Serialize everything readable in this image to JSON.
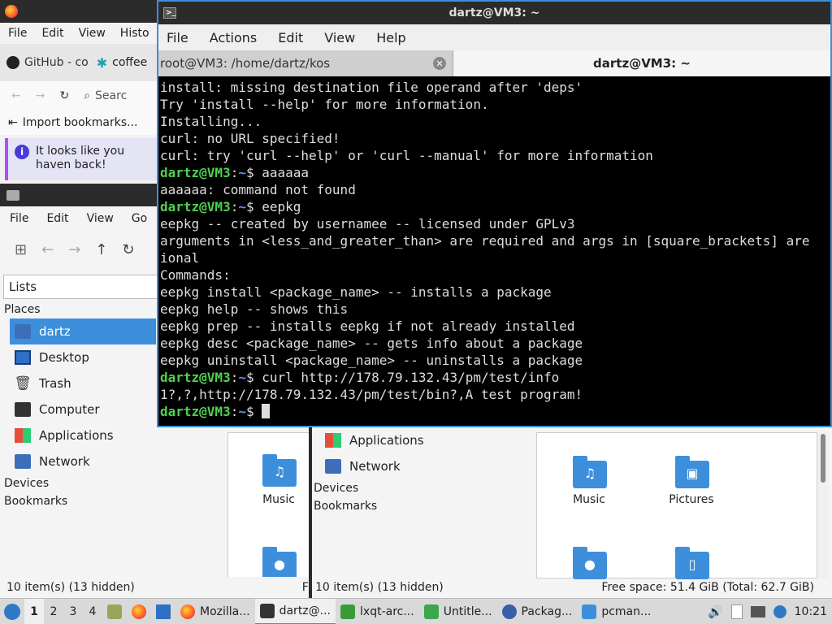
{
  "firefox": {
    "menu": [
      "File",
      "Edit",
      "View",
      "Histo"
    ],
    "tabs": [
      "GitHub - co",
      "coffee"
    ],
    "search_placeholder": "Searc",
    "bookmark": "Import bookmarks...",
    "notice": "It looks like you haven back!"
  },
  "file_manager_left": {
    "menu": [
      "File",
      "Edit",
      "View",
      "Go"
    ],
    "lists_label": "Lists",
    "places_header": "Places",
    "places": [
      "dartz",
      "Desktop",
      "Trash",
      "Computer",
      "Applications",
      "Network"
    ],
    "devices_header": "Devices",
    "bookmarks_header": "Bookmarks",
    "folder_music": "Music",
    "status": "10 item(s) (13 hidden)",
    "status_trailing": "F"
  },
  "file_manager_right": {
    "places": [
      "Applications",
      "Network"
    ],
    "devices_header": "Devices",
    "bookmarks_header": "Bookmarks",
    "folders": [
      "Music",
      "Pictures"
    ],
    "status": "10 item(s) (13 hidden)",
    "free_space": "Free space: 51.4 GiB (Total: 62.7 GiB)"
  },
  "terminal": {
    "title": "dartz@VM3: ~",
    "menu": [
      "File",
      "Actions",
      "Edit",
      "View",
      "Help"
    ],
    "tab_inactive": "root@VM3: /home/dartz/kos",
    "tab_active": "dartz@VM3: ~",
    "prompt_user": "dartz@VM3",
    "prompt_path": "~",
    "lines": {
      "l1": "install: missing destination file operand after 'deps'",
      "l2": "Try 'install --help' for more information.",
      "l3": "Installing...",
      "l4": "curl: no URL specified!",
      "l5": "curl: try 'curl --help' or 'curl --manual' for more information",
      "c1": " aaaaaa",
      "l6": "aaaaaa: command not found",
      "c2": " eepkg",
      "l7": "eepkg -- created by usernamee -- licensed under GPLv3",
      "l8": "arguments in <less_and_greater_than> are required and args in [square_brackets] are",
      "l9": "ional",
      "l10": "Commands:",
      "l11": "eepkg install <package_name> -- installs a package",
      "l12": "eepkg help -- shows this",
      "l13": "eepkg prep -- installs eepkg if not already installed",
      "l14": "eepkg desc <package_name> -- gets info about a package",
      "l15": "eepkg uninstall <package_name> -- uninstalls a package",
      "c3": " curl http://178.79.132.43/pm/test/info",
      "l16": "1?,?,http://178.79.132.43/pm/test/bin?,A test program!"
    }
  },
  "taskbar": {
    "workspaces": [
      "1",
      "2",
      "3",
      "4"
    ],
    "tasks": [
      "Mozilla...",
      "dartz@...",
      "lxqt-arc...",
      "Untitle...",
      "Packag...",
      "pcman..."
    ],
    "clock": "10:21"
  }
}
